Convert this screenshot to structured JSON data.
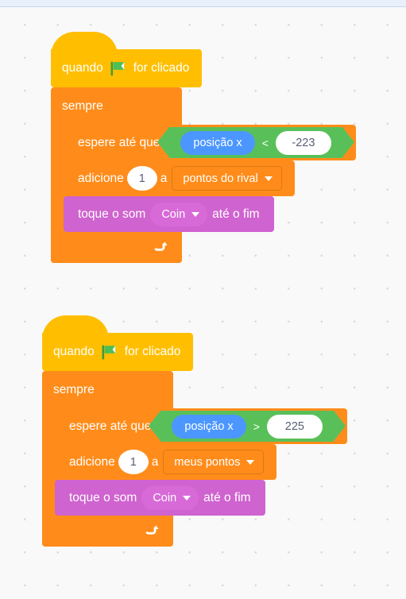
{
  "app": {
    "canvas_background": "#f9f9f9",
    "grid_dot_color": "#d9d9d9",
    "top_bar_color": "#e8f0fb"
  },
  "palette": {
    "events_yellow": "#ffbf00",
    "control_orange": "#ff8c1a",
    "operators_green": "#59c059",
    "motion_blue": "#4c97ff",
    "sound_magenta": "#cf63cf",
    "text_white": "#ffffff",
    "input_text": "#575e75"
  },
  "scripts": [
    {
      "id": "script-1",
      "hat": {
        "prefix": "quando",
        "icon": "green-flag-icon",
        "suffix": "for clicado"
      },
      "loop": {
        "label": "sempre",
        "loop_icon": "loop-arrow-icon"
      },
      "blocks": [
        {
          "type": "wait-until",
          "label": "espere até que",
          "condition": {
            "left_reporter": "posição x",
            "operator": "<",
            "right_value": "-223"
          }
        },
        {
          "type": "change-variable",
          "label_before": "adicione",
          "amount": "1",
          "label_middle": "a",
          "variable": "pontos do rival"
        },
        {
          "type": "play-sound-until-done",
          "label_before": "toque o som",
          "sound": "Coin",
          "label_after": "até o fim"
        }
      ]
    },
    {
      "id": "script-2",
      "hat": {
        "prefix": "quando",
        "icon": "green-flag-icon",
        "suffix": "for clicado"
      },
      "loop": {
        "label": "sempre",
        "loop_icon": "loop-arrow-icon"
      },
      "blocks": [
        {
          "type": "wait-until",
          "label": "espere até que",
          "condition": {
            "left_reporter": "posição x",
            "operator": ">",
            "right_value": "225"
          }
        },
        {
          "type": "change-variable",
          "label_before": "adicione",
          "amount": "1",
          "label_middle": "a",
          "variable": "meus pontos"
        },
        {
          "type": "play-sound-until-done",
          "label_before": "toque o som",
          "sound": "Coin",
          "label_after": "até o fim"
        }
      ]
    }
  ]
}
